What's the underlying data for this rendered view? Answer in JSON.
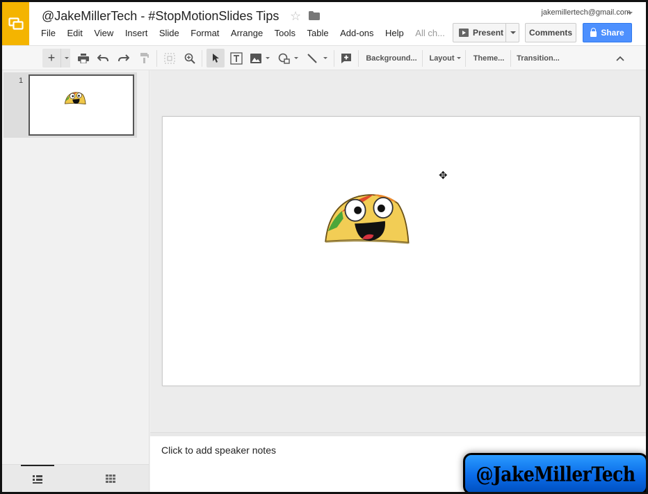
{
  "header": {
    "title": "@JakeMillerTech - #StopMotionSlides Tips",
    "account": "jakemillertech@gmail.com",
    "menu": [
      "File",
      "Edit",
      "View",
      "Insert",
      "Slide",
      "Format",
      "Arrange",
      "Tools",
      "Table",
      "Add-ons",
      "Help"
    ],
    "menu_status": "All ch...",
    "present_label": "Present",
    "comments_label": "Comments",
    "share_label": "Share",
    "accent_color": "#f4b400",
    "share_color": "#4d90fe"
  },
  "toolbar": {
    "background_label": "Background...",
    "layout_label": "Layout",
    "theme_label": "Theme...",
    "transition_label": "Transition..."
  },
  "filmstrip": {
    "slides": [
      {
        "number": "1"
      }
    ]
  },
  "notes": {
    "placeholder": "Click to add speaker notes"
  },
  "watermark": {
    "text": "@JakeMillerTech"
  }
}
